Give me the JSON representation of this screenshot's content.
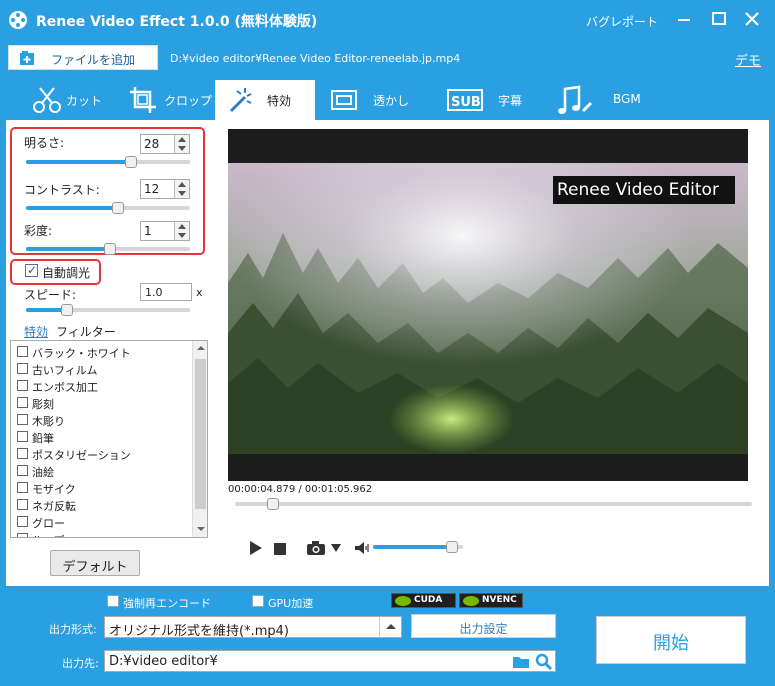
{
  "app": {
    "title": "Renee Video Effect 1.0.0 (無料体験版)",
    "bug_report": "バグレポート"
  },
  "file": {
    "add_file_label": "ファイルを追加",
    "path": "D:¥video editor¥Renee Video Editor-reneelab.jp.mp4",
    "demo_link": "デモ"
  },
  "tabs": [
    {
      "label": "カット",
      "icon": "cut-icon",
      "active": false
    },
    {
      "label": "クロップ",
      "icon": "crop-icon",
      "active": false
    },
    {
      "label": "特効",
      "icon": "magic-wand-icon",
      "active": true
    },
    {
      "label": "透かし",
      "icon": "watermark-icon",
      "active": false
    },
    {
      "label": "字幕",
      "icon": "subtitle-icon",
      "active": false
    },
    {
      "label": "BGM",
      "icon": "music-icon",
      "active": false
    }
  ],
  "adjust": {
    "brightness_label": "明るさ:",
    "brightness_value": "28",
    "brightness_level": 0.64,
    "contrast_label": "コントラスト:",
    "contrast_value": "12",
    "contrast_level": 0.56,
    "saturation_label": "彩度:",
    "saturation_value": "1",
    "saturation_level": 0.51,
    "auto_light_label": "自動調光",
    "auto_light_checked": true,
    "speed_label": "スピード:",
    "speed_value": "1.0",
    "speed_unit": "x",
    "speed_level": 0.25
  },
  "effects": {
    "tab_effect": "特効",
    "tab_filter": "フィルター",
    "items": [
      "バラック・ホワイト",
      "古いフィルム",
      "エンボス加工",
      "彫刻",
      "木彫り",
      "鉛筆",
      "ポスタリゼーション",
      "油絵",
      "モザイク",
      "ネガ反転",
      "グロー",
      "ループ"
    ],
    "default_button": "デフォルト"
  },
  "player": {
    "watermark_text": "Renee Video Editor",
    "time": "00:00:04.879 / 00:01:05.962",
    "seek_fraction": 0.074,
    "volume_fraction": 0.88
  },
  "output": {
    "reencode_label": "強制再エンコード",
    "gpu_label": "GPU加速",
    "cuda_label": "CUDA",
    "nvenc_label": "NVENC",
    "format_label": "出力形式:",
    "format_value": "オリジナル形式を維持(*.mp4)",
    "settings_button": "出力設定",
    "dest_label": "出力先:",
    "dest_value": "D:¥video editor¥",
    "start_button": "開始"
  },
  "colors": {
    "accent": "#2a9fe2",
    "highlight_box": "#e8353a"
  }
}
